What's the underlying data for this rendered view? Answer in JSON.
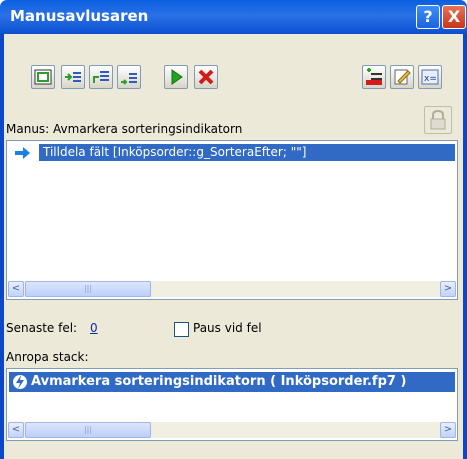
{
  "window": {
    "title": "Manusavlusaren"
  },
  "titlebar_buttons": {
    "help": "?",
    "close": "X"
  },
  "toolbar": {
    "left_icons": [
      "step-icon",
      "step-into-icon",
      "step-out-icon",
      "set-next-step-icon",
      "run-icon",
      "halt-icon"
    ],
    "right_icons": [
      "breakpoint-icon",
      "edit-script-icon",
      "data-viewer-icon"
    ]
  },
  "script": {
    "label": "Manus: Avmarkera sorteringsindikatorn",
    "steps": [
      "Tilldela fält [Inköpsorder::g_SorteraEfter; \"\"]"
    ]
  },
  "last_error": {
    "label": "Senaste fel:",
    "value": "0"
  },
  "pause_on_error": {
    "label": "Paus vid fel",
    "checked": false
  },
  "call_stack": {
    "label": "Anropa stack:",
    "items": [
      "Avmarkera sorteringsindikatorn ( Inköpsorder.fp7 )"
    ]
  },
  "scrollbar": {
    "thumb_glyph": "|||",
    "left_glyph": "<",
    "right_glyph": ">"
  }
}
